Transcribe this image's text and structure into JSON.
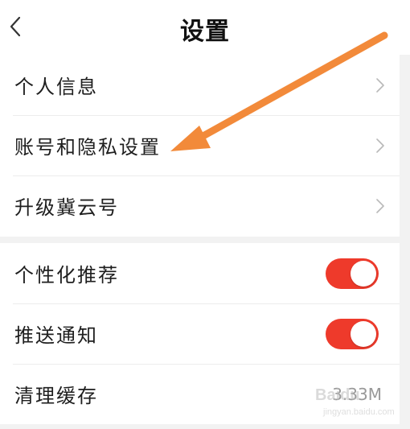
{
  "header": {
    "title": "设置",
    "back_icon": "chevron-left-icon"
  },
  "sections": [
    {
      "items": [
        {
          "label": "个人信息",
          "trailing": "chevron-right-icon"
        },
        {
          "label": "账号和隐私设置",
          "trailing": "chevron-right-icon"
        },
        {
          "label": "升级冀云号",
          "trailing": "chevron-right-icon"
        }
      ]
    },
    {
      "items": [
        {
          "label": "个性化推荐",
          "toggle_on": true
        },
        {
          "label": "推送通知",
          "toggle_on": true
        },
        {
          "label": "清理缓存",
          "value": "3.33M"
        }
      ]
    }
  ],
  "annotation": {
    "type": "arrow",
    "color": "#f28a3a"
  },
  "watermark": {
    "brand": "Baidu",
    "subtitle": "jingyan.baidu.com"
  },
  "colors": {
    "toggle_on": "#ee3a2b",
    "background": "#f2f2f2",
    "accent_arrow": "#f28a3a"
  }
}
